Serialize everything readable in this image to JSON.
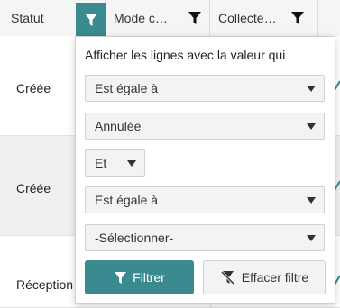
{
  "header": {
    "columns": [
      {
        "title": "Statut",
        "filter_active": true
      },
      {
        "title": "Mode c…",
        "filter_active": false
      },
      {
        "title": "Collecte…",
        "filter_active": false
      }
    ]
  },
  "rows": [
    {
      "statut": "Créée"
    },
    {
      "statut": "Créée"
    },
    {
      "statut": "Réception"
    }
  ],
  "filter_popup": {
    "caption": "Afficher les lignes avec la valeur qui",
    "operator1": "Est égale à",
    "value1": "Annulée",
    "logic": "Et",
    "operator2": "Est égale à",
    "value2": "-Sélectionner-",
    "filter_button": "Filtrer",
    "clear_button": "Effacer filtre"
  },
  "colors": {
    "accent": "#3a8a8f",
    "header_bg": "#f5f5f5",
    "row_alt_bg": "#f0f0f0"
  },
  "icons": {
    "filter": "filter-icon",
    "clear_filter": "clear-filter-icon",
    "dropdown": "chevron-down-icon"
  }
}
